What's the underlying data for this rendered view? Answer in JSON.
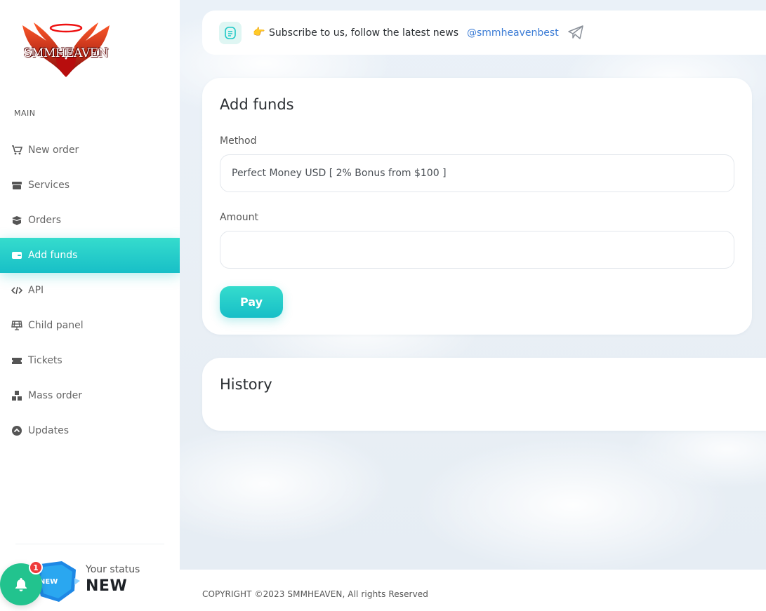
{
  "sidebar": {
    "logo_text": "SMMHEAVEN",
    "section_title": "MAIN",
    "items": [
      {
        "label": "New order",
        "icon": "cart-icon"
      },
      {
        "label": "Services",
        "icon": "store-icon"
      },
      {
        "label": "Orders",
        "icon": "box-icon"
      },
      {
        "label": "Add funds",
        "icon": "wallet-icon",
        "active": true
      },
      {
        "label": "API",
        "icon": "code-icon"
      },
      {
        "label": "Child panel",
        "icon": "solar-panel-icon"
      },
      {
        "label": "Tickets",
        "icon": "ticket-icon"
      },
      {
        "label": "Mass order",
        "icon": "boxes-icon"
      },
      {
        "label": "Updates",
        "icon": "chevron-up-circle-icon"
      }
    ],
    "status": {
      "label": "Your status",
      "value": "NEW",
      "badge_text": "NEW"
    },
    "notifications": {
      "count": "1",
      "icon": "bell-icon"
    }
  },
  "news": {
    "icon": "news-icon",
    "hand": "👉",
    "text": "Subscribe to us, follow the latest news",
    "link": "@smmheavenbest",
    "link_icon": "telegram-icon"
  },
  "add_funds": {
    "title": "Add funds",
    "method_label": "Method",
    "method_value": "Perfect Money USD [ 2% Bonus from $100 ]",
    "amount_label": "Amount",
    "amount_value": "",
    "pay_label": "Pay"
  },
  "history": {
    "title": "History"
  },
  "footer": {
    "copyright": "COPYRIGHT ©2023 SMMHEAVEN, All rights Reserved"
  },
  "colors": {
    "accent": "#1fc8c6",
    "accent_light": "#35dccd",
    "bell": "#22c38e",
    "badge_red": "#ee3a3a",
    "link": "#3a7bd5",
    "status_badge": "#1e88e5"
  }
}
